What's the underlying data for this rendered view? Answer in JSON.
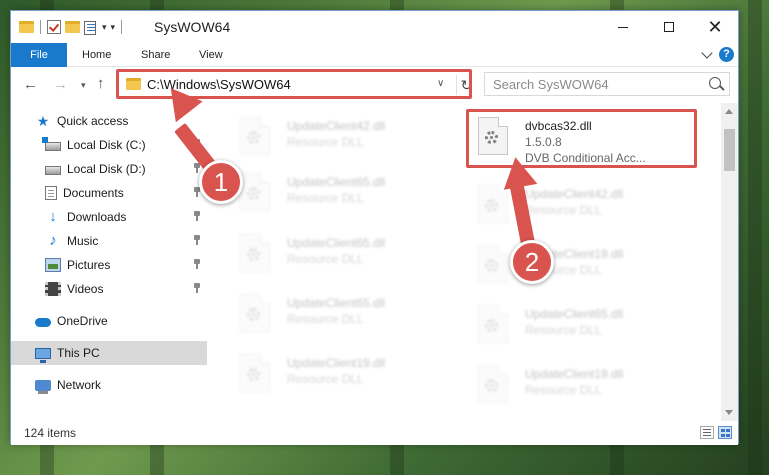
{
  "window": {
    "title": "SysWOW64",
    "controls": {
      "minimize": "",
      "maximize": "",
      "close": "✕"
    }
  },
  "ribbon": {
    "tabs": [
      {
        "label": "File"
      },
      {
        "label": "Home"
      },
      {
        "label": "Share"
      },
      {
        "label": "View"
      }
    ]
  },
  "navigation": {
    "back": "←",
    "forward": "→",
    "recent": "▾",
    "up": "↑",
    "address": "C:\\Windows\\SysWOW64",
    "address_dropdown": "∨",
    "refresh": "↻",
    "search_placeholder": "Search SysWOW64"
  },
  "sidebar": {
    "items": [
      {
        "label": "Quick access",
        "icon": "star-icon"
      },
      {
        "label": "Local Disk (C:)",
        "icon": "drive-icon",
        "pinned": true
      },
      {
        "label": "Local Disk (D:)",
        "icon": "drive-icon",
        "pinned": true
      },
      {
        "label": "Documents",
        "icon": "documents-icon",
        "pinned": true
      },
      {
        "label": "Downloads",
        "icon": "downloads-icon",
        "pinned": true
      },
      {
        "label": "Music",
        "icon": "music-icon",
        "pinned": true
      },
      {
        "label": "Pictures",
        "icon": "pictures-icon",
        "pinned": true
      },
      {
        "label": "Videos",
        "icon": "videos-icon",
        "pinned": true
      },
      {
        "label": "OneDrive",
        "icon": "onedrive-icon"
      },
      {
        "label": "This PC",
        "icon": "computer-icon",
        "selected": true
      },
      {
        "label": "Network",
        "icon": "network-icon"
      }
    ]
  },
  "files": {
    "highlighted": {
      "name": "dvbcas32.dll",
      "version": "1.5.0.8",
      "description": "DVB Conditional Acc..."
    },
    "background": [
      {
        "name": "UpdateClient42.dll",
        "type": "Resource DLL"
      },
      {
        "name": "UpdateClient65.dll",
        "type": "Resource DLL"
      },
      {
        "name": "UpdateClient42.dll",
        "type": "Resource DLL"
      },
      {
        "name": "UpdateClient65.dll",
        "type": "Resource DLL"
      },
      {
        "name": "UpdateClient19.dll",
        "type": "Resource DLL"
      },
      {
        "name": "UpdateClient65.dll",
        "type": "Resource DLL"
      },
      {
        "name": "UpdateClient65.dll",
        "type": "Resource DLL"
      },
      {
        "name": "UpdateClient19.dll",
        "type": "Resource DLL"
      },
      {
        "name": "UpdateClient19.dll",
        "type": "Resource DLL"
      }
    ]
  },
  "status": {
    "item_count": "124 items"
  },
  "annotations": {
    "step1": "1",
    "step2": "2",
    "color": "#d9534f"
  },
  "colors": {
    "accent": "#1979ca",
    "highlight": "#d9534f"
  }
}
